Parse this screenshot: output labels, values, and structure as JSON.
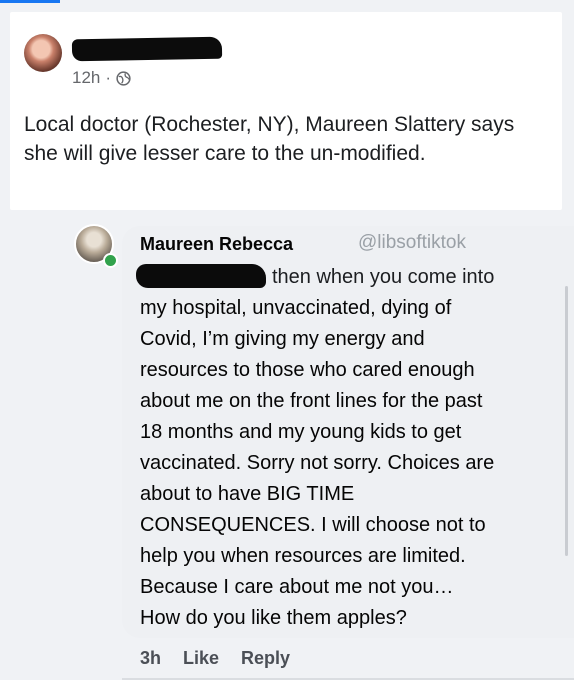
{
  "post": {
    "time": "12h",
    "separator": "·",
    "text": "Local doctor (Rochester, NY), Maureen Slattery says she will give lesser care to the un-modified."
  },
  "comment": {
    "author": "Maureen Rebecca",
    "watermark": "@libsoftiktok",
    "first_line": "then when you come into",
    "lines": [
      "my hospital, unvaccinated, dying of",
      "Covid, I’m giving my energy and",
      "resources to those who cared enough",
      "about me on the front lines for the past",
      "18 months and my young kids to get",
      "vaccinated. Sorry not sorry. Choices are",
      "about to have BIG TIME",
      "CONSEQUENCES. I will choose not to",
      "help you when resources are limited.",
      "Because I care about me not you…",
      "How do you like them apples?"
    ],
    "time": "3h",
    "like_label": "Like",
    "reply_label": "Reply"
  },
  "icons": {
    "audience": "globe-icon",
    "presence": "online-status-icon"
  },
  "colors": {
    "accent": "#1877f2",
    "online": "#31a24c",
    "bubble": "#eef0f3",
    "secondary_text": "#65676b"
  }
}
